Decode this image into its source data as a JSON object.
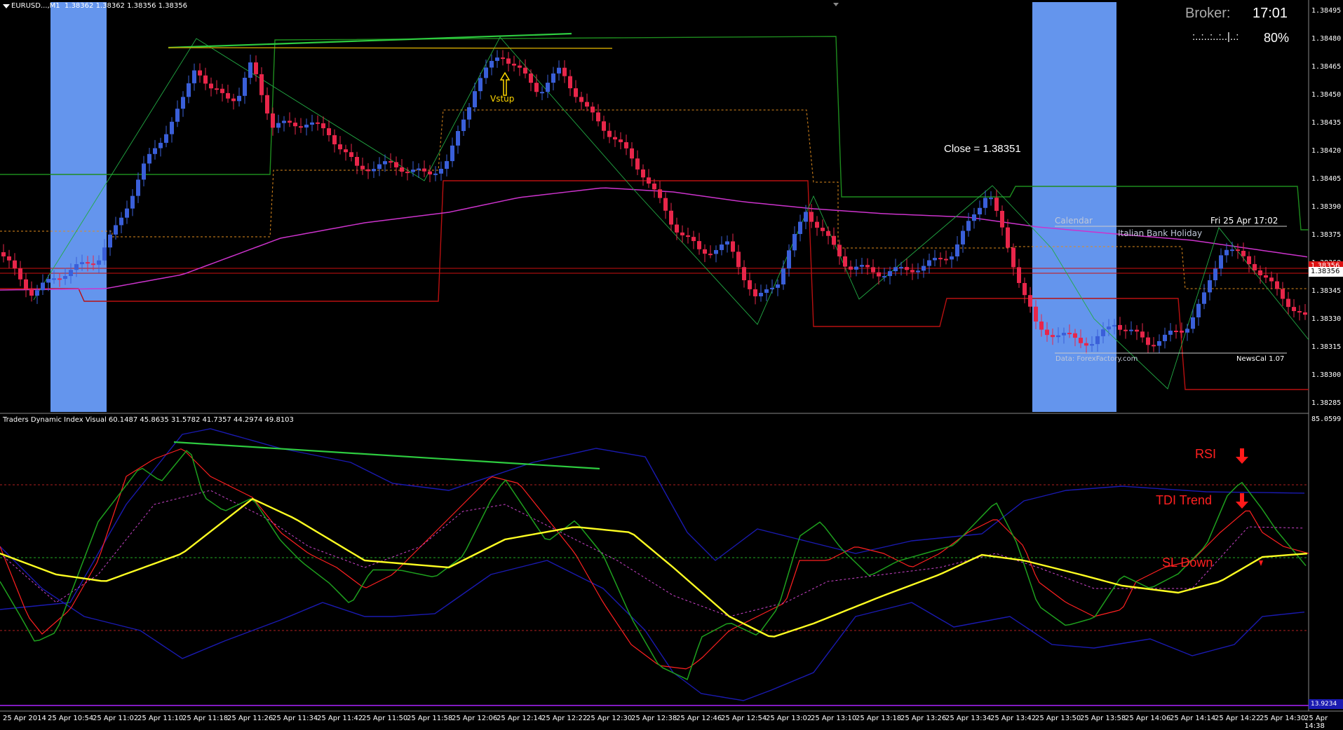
{
  "header": {
    "symbol": "EURUSD...,M1",
    "quotes": "1.38362 1.38362 1.38356 1.38356"
  },
  "broker": {
    "label": "Broker:",
    "time": "17:01",
    "progress_text": ":..:..:..:..|..:",
    "progress_pct": "80%"
  },
  "annotations": {
    "vstup": "Vstup",
    "close": "Close = 1.38351",
    "calendar": "Calendar",
    "event_date": "Fri 25 Apr 17:02",
    "event_name": "Italian Bank Holiday",
    "data_source": "Data: ForexFactory.com",
    "newscal": "NewsCal 1.07"
  },
  "price_scale": [
    "1.38495",
    "1.38480",
    "1.38465",
    "1.38450",
    "1.38435",
    "1.38420",
    "1.38405",
    "1.38390",
    "1.38375",
    "1.38360",
    "1.38345",
    "1.38330",
    "1.38315",
    "1.38300",
    "1.38285"
  ],
  "current_price": "1.38356",
  "indicator": {
    "title": "Traders Dynamic Index Visual 60.1487 45.8635 31.5782 41.7357 44.2974 49.8103",
    "top_value": "85.0599",
    "bottom_value": "13.9234",
    "rsi_label": "RSI",
    "trend_label": "TDI Trend",
    "sl_label": "SL Down",
    "bottom_extra": "13.9234b"
  },
  "time_axis": [
    "25 Apr 2014",
    "25 Apr 10:54",
    "25 Apr 11:02",
    "25 Apr 11:10",
    "25 Apr 11:18",
    "25 Apr 11:26",
    "25 Apr 11:34",
    "25 Apr 11:42",
    "25 Apr 11:50",
    "25 Apr 11:58",
    "25 Apr 12:06",
    "25 Apr 12:14",
    "25 Apr 12:22",
    "25 Apr 12:30",
    "25 Apr 12:38",
    "25 Apr 12:46",
    "25 Apr 12:54",
    "25 Apr 13:02",
    "25 Apr 13:10",
    "25 Apr 13:18",
    "25 Apr 13:26",
    "25 Apr 13:34",
    "25 Apr 13:42",
    "25 Apr 13:50",
    "25 Apr 13:58",
    "25 Apr 14:06",
    "25 Apr 14:14",
    "25 Apr 14:22",
    "25 Apr 14:30",
    "25 Apr 14:38"
  ],
  "colors": {
    "bull": "#3a5fd9",
    "bear": "#e8264a",
    "session": "#6495ed",
    "ma": "#cc33cc",
    "green_line": "#1e8c1e",
    "red_line": "#cc1111",
    "tdi_rsi": "#1ea01e",
    "tdi_signal": "#ff2020",
    "tdi_base": "#ffff22",
    "tdi_band": "#1a1ab0"
  }
}
